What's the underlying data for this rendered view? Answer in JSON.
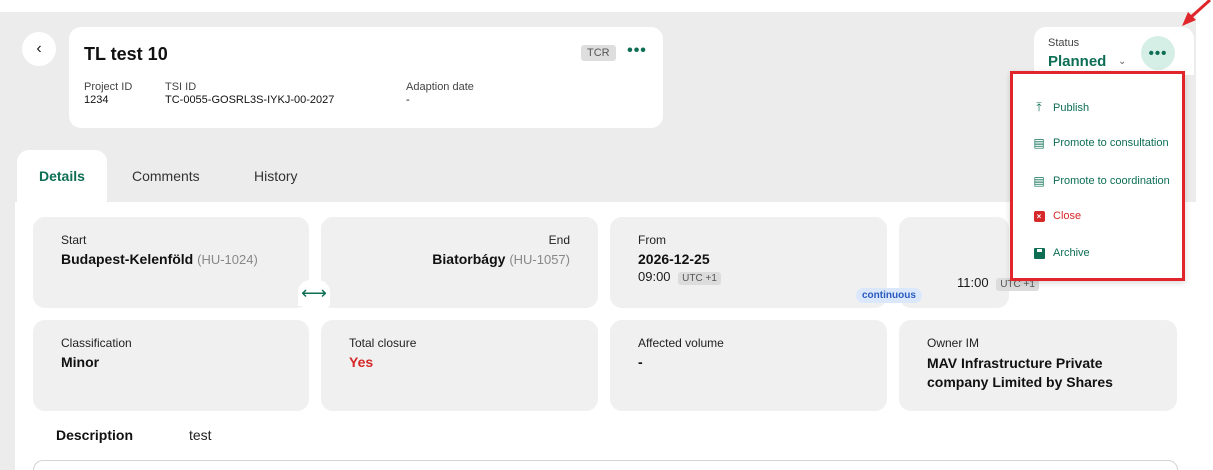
{
  "header": {
    "title": "TL test 10",
    "badge": "TCR",
    "more_label": "•••",
    "back_label": "‹",
    "meta": [
      {
        "label": "Project ID",
        "value": "1234"
      },
      {
        "label": "TSI ID",
        "value": "TC-0055-GOSRL3S-IYKJ-00-2027"
      },
      {
        "label": "Adaption date",
        "value": "-"
      }
    ]
  },
  "status": {
    "label": "Status",
    "value": "Planned",
    "chevron": "⌄",
    "more_label": "•••"
  },
  "tabs": [
    {
      "label": "Details",
      "active": true
    },
    {
      "label": "Comments",
      "active": false
    },
    {
      "label": "History",
      "active": false
    }
  ],
  "route": {
    "start_label": "Start",
    "start_value": "Budapest-Kelenföld",
    "start_code": "(HU-1024)",
    "end_label": "End",
    "end_value": "Biatorbágy",
    "end_code": "(HU-1057)",
    "arrow": "⟷"
  },
  "period": {
    "from_label": "From",
    "from_date": "2026-12-25",
    "from_time": "09:00",
    "from_tz": "UTC +1",
    "to_time": "11:00",
    "to_tz": "UTC +1",
    "mode": "continuous"
  },
  "info": {
    "classification_label": "Classification",
    "classification_value": "Minor",
    "closure_label": "Total closure",
    "closure_value": "Yes",
    "volume_label": "Affected volume",
    "volume_value": "-",
    "owner_label": "Owner IM",
    "owner_value": "MAV Infrastructure Private company Limited by Shares"
  },
  "description": {
    "label": "Description",
    "value": "test"
  },
  "menu": {
    "items": [
      {
        "label": "Publish",
        "icon": "upload-icon"
      },
      {
        "label": "Promote to consultation",
        "icon": "document-icon"
      },
      {
        "label": "Promote to coordination",
        "icon": "document-icon"
      },
      {
        "label": "Close",
        "icon": "close-icon"
      },
      {
        "label": "Archive",
        "icon": "archive-icon"
      }
    ]
  },
  "colors": {
    "accent": "#0d6e54",
    "danger": "#d62828",
    "highlight_border": "#e0262b"
  }
}
